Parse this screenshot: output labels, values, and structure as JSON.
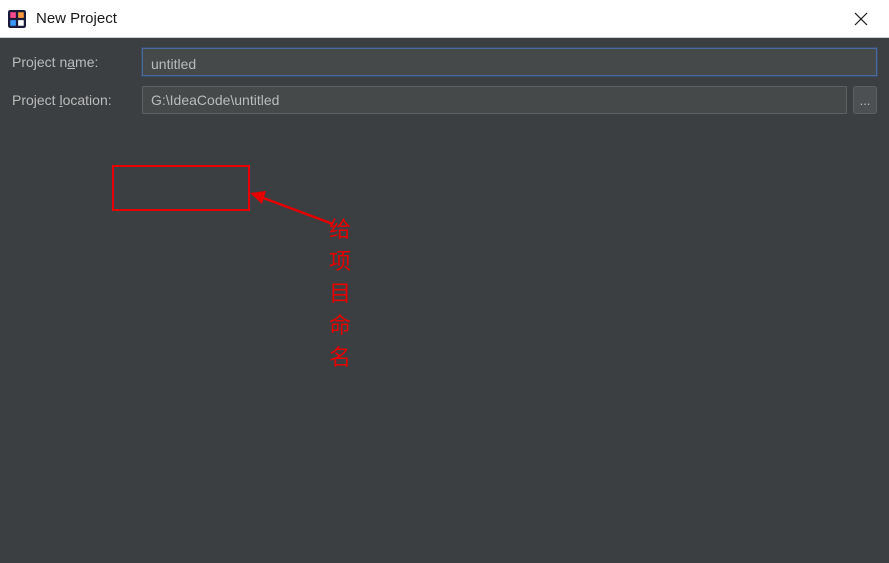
{
  "window": {
    "title": "New Project"
  },
  "form": {
    "name_label_prefix": "Project n",
    "name_label_mnemonic": "a",
    "name_label_suffix": "me:",
    "name_value": "untitled",
    "location_label_prefix": "Project ",
    "location_label_mnemonic": "l",
    "location_label_suffix": "ocation:",
    "location_value": "G:\\IdeaCode\\untitled",
    "browse_label": "..."
  },
  "annotation": {
    "text": "给项目命名"
  }
}
